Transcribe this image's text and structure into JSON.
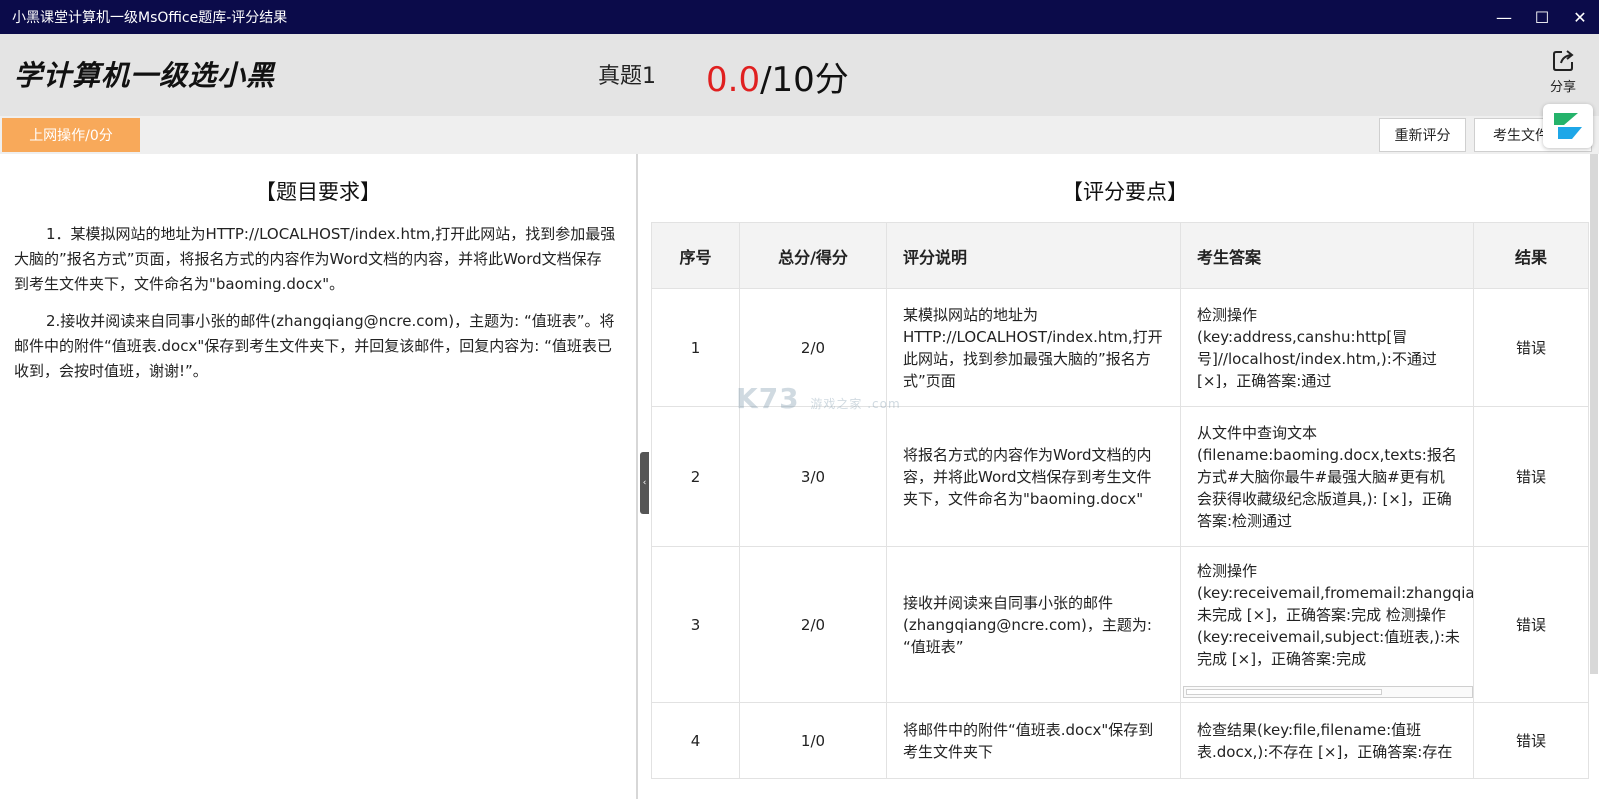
{
  "window": {
    "title": "小黑课堂计算机一级MsOffice题库-评分结果",
    "controls": {
      "minimize": "—",
      "maximize": "☐",
      "close": "✕"
    }
  },
  "header": {
    "logo": "学计算机一级选小黑",
    "exam_name": "真题1",
    "score_got": "0.0",
    "score_total": "/10分",
    "share_label": "分享"
  },
  "toolbar": {
    "category_tab": "上网操作/0分",
    "rescore_button": "重新评分",
    "student_file_button": "考生文件"
  },
  "left": {
    "title": "【题目要求】",
    "requirements": [
      "1．某模拟网站的地址为HTTP://LOCALHOST/index.htm,打开此网站，找到参加最强大脑的”报名方式”页面，将报名方式的内容作为Word文档的内容，并将此Word文档保存到考生文件夹下，文件命名为\"baoming.docx\"。",
      "2.接收并阅读来自同事小张的邮件(zhangqiang@ncre.com)，主题为: “值班表”。将邮件中的附件“值班表.docx\"保存到考生文件夹下，并回复该邮件，回复内容为: “值班表已收到，会按时值班，谢谢!”。"
    ]
  },
  "right": {
    "title": "【评分要点】",
    "columns": [
      "序号",
      "总分/得分",
      "评分说明",
      "考生答案",
      "结果"
    ],
    "rows": [
      {
        "no": "1",
        "score": "2/0",
        "desc": "某模拟网站的地址为HTTP://LOCALHOST/index.htm,打开此网站，找到参加最强大脑的”报名方式”页面",
        "answer": "检测操作(key:address,canshu:http[冒号]//localhost/index.htm,):不通过[×]，正确答案:通过",
        "result": "错误"
      },
      {
        "no": "2",
        "score": "3/0",
        "desc": "将报名方式的内容作为Word文档的内容，并将此Word文档保存到考生文件夹下，文件命名为\"baoming.docx\"",
        "answer": "从文件中查询文本(filename:baoming.docx,texts:报名方式#大脑你最牛#最强大脑#更有机会获得收藏级纪念版道具,): [×]，正确答案:检测通过",
        "result": "错误"
      },
      {
        "no": "3",
        "score": "2/0",
        "desc": "接收并阅读来自同事小张的邮件(zhangqiang@ncre.com)，主题为: “值班表”",
        "answer": "检测操作(key:receivemail,fromemail:zhangqia未完成 [×]，正确答案:完成 检测操作(key:receivemail,subject:值班表,):未完成 [×]，正确答案:完成",
        "result": "错误"
      },
      {
        "no": "4",
        "score": "1/0",
        "desc": "将邮件中的附件“值班表.docx\"保存到考生文件夹下",
        "answer": "检查结果(key:file,filename:值班表.docx,):不存在 [×]，正确答案:存在",
        "result": "错误"
      }
    ]
  },
  "watermark": {
    "main": "K73",
    "sub": "游戏之家 .com"
  }
}
